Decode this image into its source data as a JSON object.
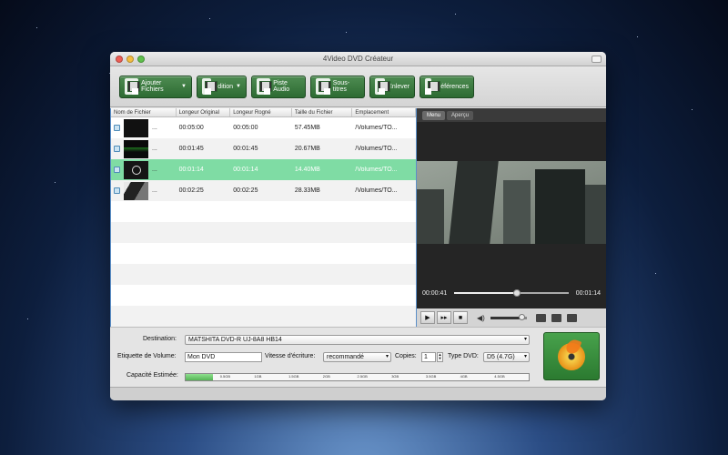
{
  "window": {
    "title": "4Video DVD Créateur"
  },
  "toolbar": {
    "buttons": [
      {
        "label": "Ajouter Fichiers",
        "dropdown": true,
        "icon": "add-file-icon"
      },
      {
        "label": "Edition",
        "dropdown": true,
        "icon": "edit-film-icon"
      },
      {
        "label": "Piste Audio",
        "dropdown": false,
        "icon": "audio-track-icon"
      },
      {
        "label": "Sous-titres",
        "dropdown": false,
        "icon": "subtitle-icon"
      },
      {
        "label": "Enlever",
        "dropdown": false,
        "icon": "remove-icon"
      },
      {
        "label": "Préférences",
        "dropdown": false,
        "icon": "preferences-icon"
      }
    ]
  },
  "file_list": {
    "headers": [
      "Nom de Fichier",
      "Longeur Original",
      "Longeur Rogné",
      "Taille du Fichier",
      "Emplacement"
    ],
    "rows": [
      {
        "name": "...",
        "original": "00:05:00",
        "trimmed": "00:05:00",
        "size": "57.45MB",
        "location": "/Volumes/TO...",
        "selected": false
      },
      {
        "name": "...",
        "original": "00:01:45",
        "trimmed": "00:01:45",
        "size": "20.67MB",
        "location": "/Volumes/TO...",
        "selected": false
      },
      {
        "name": "...",
        "original": "00:01:14",
        "trimmed": "00:01:14",
        "size": "14.40MB",
        "location": "/Volumes/TO...",
        "selected": true
      },
      {
        "name": "...",
        "original": "00:02:25",
        "trimmed": "00:02:25",
        "size": "28.33MB",
        "location": "/Volumes/TO...",
        "selected": false
      }
    ]
  },
  "preview": {
    "tabs": [
      "Menu",
      "Aperçu"
    ],
    "current_time": "00:00:41",
    "total_time": "00:01:14",
    "progress": 0.55,
    "volume": 0.85
  },
  "settings": {
    "destination_label": "Destination:",
    "destination_value": "MATSHITA DVD-R   UJ-8A8 HB14",
    "volume_label": "Etiquette de Volume:",
    "volume_value": "Mon DVD",
    "speed_label": "Vitesse d'écriture:",
    "speed_value": "recommandé",
    "copies_label": "Copies:",
    "copies_value": "1",
    "dvd_type_label": "Type DVD:",
    "dvd_type_value": "D5 (4.7G)",
    "capacity_label": "Capacité Estimée:",
    "capacity_ticks": [
      "0.5GB",
      "1GB",
      "1.5GB",
      "2GB",
      "2.5GB",
      "3GB",
      "3.5GB",
      "4GB",
      "4.5GB"
    ],
    "capacity_used": 0.08
  },
  "colors": {
    "toolbar_green": "#2d6b32",
    "selected_row": "#7fdca4",
    "list_border": "#5b8fc8"
  }
}
